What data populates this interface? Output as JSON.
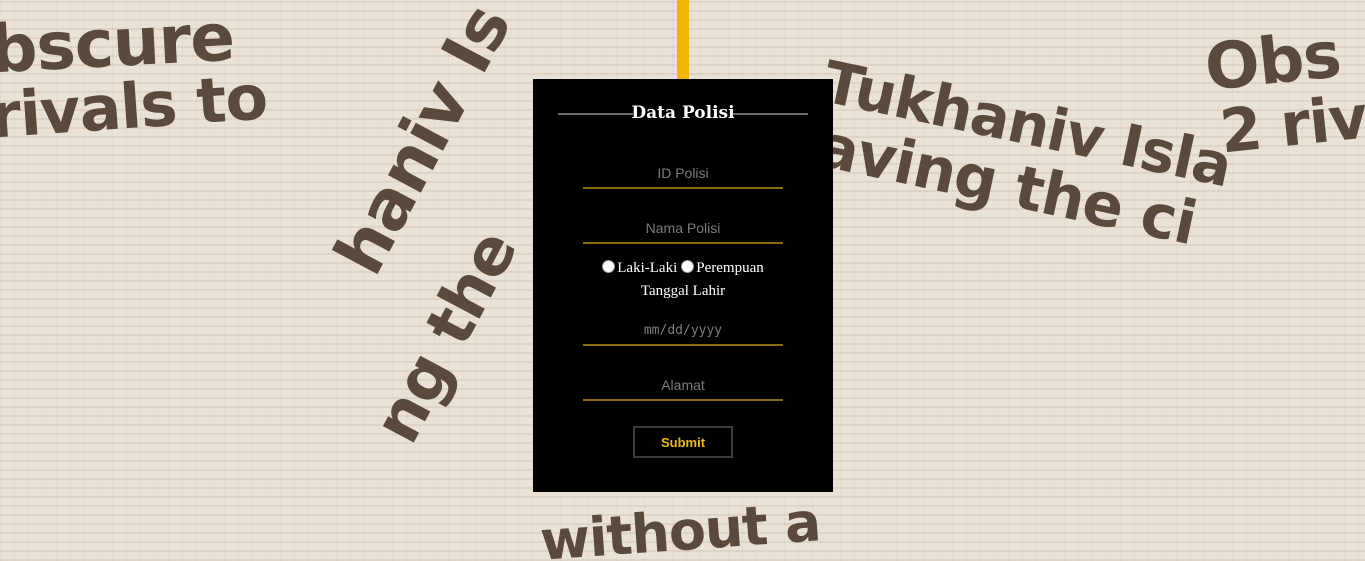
{
  "background": {
    "headlines": [
      "bscure",
      "rivals to",
      "Tukhaniv Isla",
      "aving the ci",
      "Obs",
      "2 riv",
      "haniv Is",
      "ng the",
      "without a"
    ]
  },
  "form": {
    "title": "Data Polisi",
    "id_placeholder": "ID Polisi",
    "nama_placeholder": "Nama Polisi",
    "gender_options": [
      "Laki-Laki",
      "Perempuan"
    ],
    "tanggal_label": "Tanggal Lahir",
    "tanggal_placeholder": "mm/dd/yyyy",
    "alamat_placeholder": "Alamat",
    "submit_label": "Submit"
  },
  "colors": {
    "accent": "#f2b705",
    "panel": "#000000",
    "field_underline": "#8a6a10"
  }
}
